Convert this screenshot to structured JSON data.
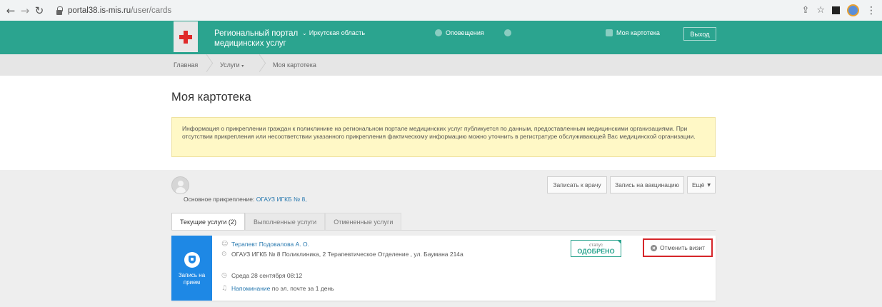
{
  "browser": {
    "url_host": "portal38.is-mis.ru",
    "url_path": "/user/cards"
  },
  "header": {
    "title_line1": "Региональный портал",
    "title_line2": "медицинских услуг",
    "region": "Иркутская область",
    "notifications": "Оповещения",
    "my_card": "Моя картотека",
    "logout": "Выход",
    "bg_color": "#2ba48f"
  },
  "breadcrumb": {
    "home": "Главная",
    "services": "Услуги",
    "current": "Моя картотека"
  },
  "page": {
    "title": "Моя картотека",
    "notice": "Информация о прикреплении граждан к поликлинике на региональном портале медицинских услуг публикуется по данным, предоставленным медицинскими организациями. При отсутствии прикрепления или несоответствии указанного прикрепления фактическому информацию можно уточнить в регистратуре обслуживающей Вас медицинской организации."
  },
  "profile": {
    "attach_label": "Основное прикрепление:",
    "attach_value": "ОГАУЗ ИГКБ № 8,"
  },
  "actions": {
    "doctor": "Записать к врачу",
    "vaccination": "Запись на вакцинацию",
    "more": "Ещё"
  },
  "tabs": [
    {
      "label": "Текущие услуги (2)",
      "active": true
    },
    {
      "label": "Выполненные услуги",
      "active": false
    },
    {
      "label": "Отмененные услуги",
      "active": false
    }
  ],
  "visit": {
    "type_label": "Запись на прием",
    "doctor": "Терапевт Подовалова А. О.",
    "address": "ОГАУЗ ИГКБ № 8 Поликлиника, 2 Терапевтическое Отделение , ул. Баумана 214а",
    "datetime": "Среда 28 сентября 08:12",
    "reminder_link": "Напоминание",
    "reminder_rest": "по эл. почте за 1 день",
    "status_caption": "статус",
    "status_value": "ОДОБРЕНО",
    "cancel": "Отменить визит",
    "side_color": "#1e88e5",
    "highlight_color": "#d6262a"
  }
}
